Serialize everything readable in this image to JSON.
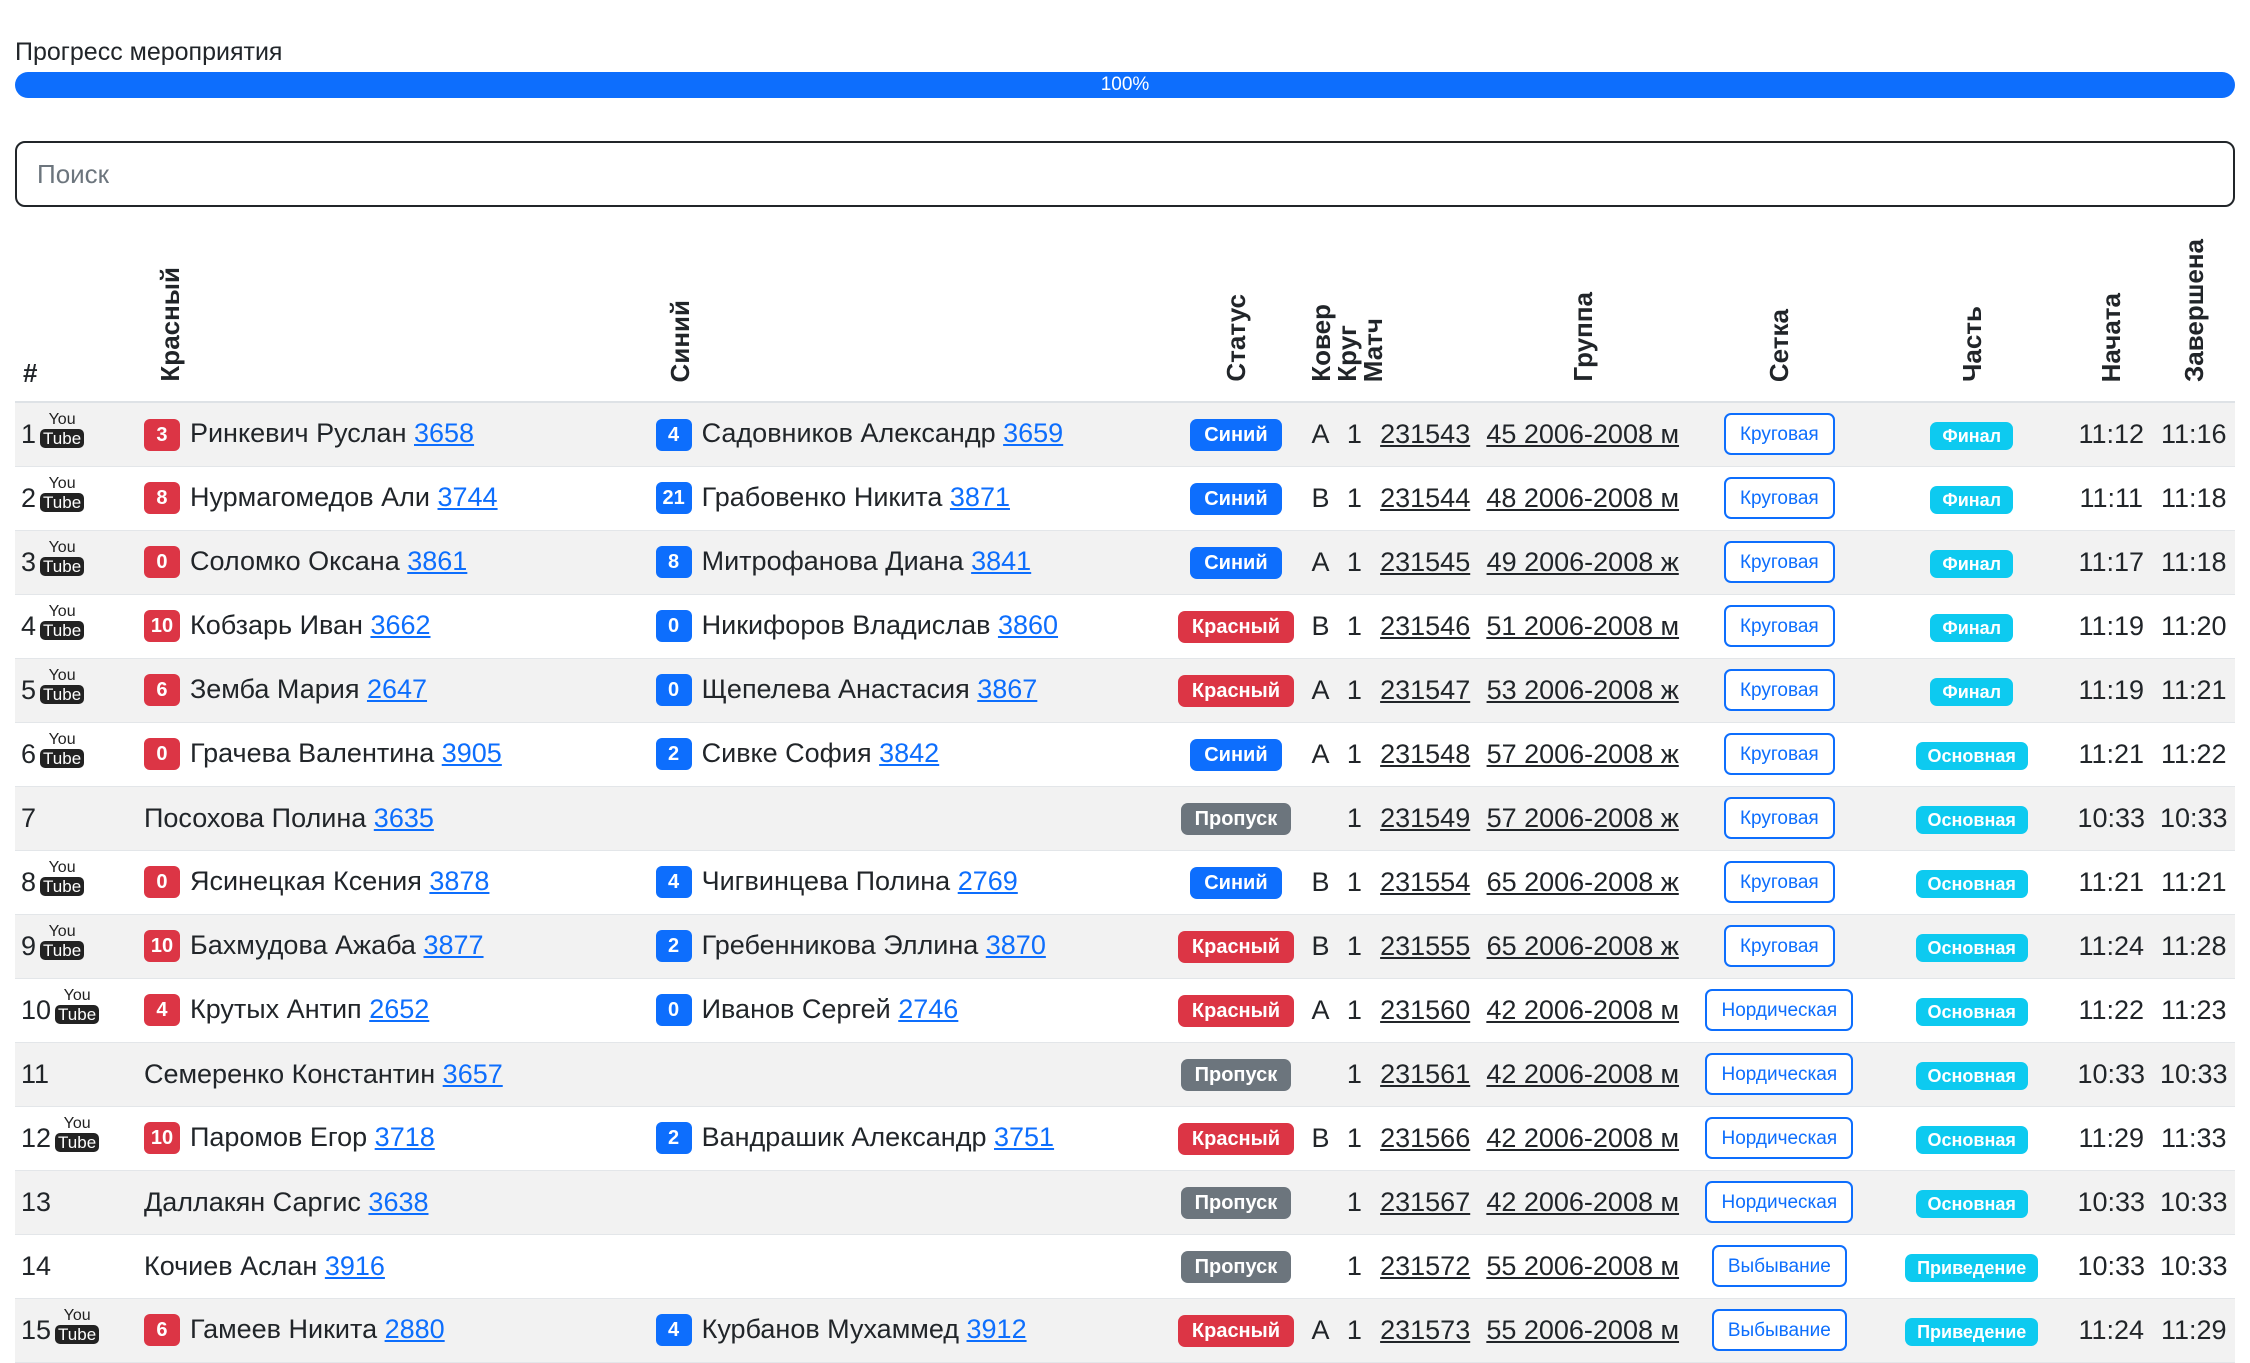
{
  "progress": {
    "label": "Прогресс мероприятия",
    "value_text": "100%",
    "value": 1.0
  },
  "search": {
    "placeholder": "Поиск",
    "value": ""
  },
  "colors": {
    "red": "#dc3545",
    "blue": "#0d6efd",
    "gray": "#6c757d",
    "cyan": "#0dcaf0"
  },
  "icons": {
    "youtube": "youtube-icon"
  },
  "youtube_logo": {
    "top": "You",
    "bottom": "Tube"
  },
  "columns": {
    "num": "#",
    "red": "Красный",
    "blue": "Синий",
    "status": "Статус",
    "mat": "Ковер",
    "round": "Круг",
    "match": "Матч",
    "group": "Группа",
    "grid": "Сетка",
    "part": "Часть",
    "start": "Начата",
    "end": "Завершена"
  },
  "rows": [
    {
      "n": "1",
      "yt": true,
      "rs": "3",
      "rn": "Ринкевич Руслан",
      "rid": "3658",
      "bs": "4",
      "bn": "Садовников Александр",
      "bid": "3659",
      "status": "Синий",
      "sc": "blue",
      "mat": "A",
      "round": "1",
      "match": "231543",
      "group": "45 2006-2008 м",
      "grid": "Круговая",
      "part": "Финал",
      "start": "11:12",
      "end": "11:16"
    },
    {
      "n": "2",
      "yt": true,
      "rs": "8",
      "rn": "Нурмагомедов Али",
      "rid": "3744",
      "bs": "21",
      "bn": "Грабовенко Никита",
      "bid": "3871",
      "status": "Синий",
      "sc": "blue",
      "mat": "B",
      "round": "1",
      "match": "231544",
      "group": "48 2006-2008 м",
      "grid": "Круговая",
      "part": "Финал",
      "start": "11:11",
      "end": "11:18"
    },
    {
      "n": "3",
      "yt": true,
      "rs": "0",
      "rn": "Соломко Оксана",
      "rid": "3861",
      "bs": "8",
      "bn": "Митрофанова Диана",
      "bid": "3841",
      "status": "Синий",
      "sc": "blue",
      "mat": "A",
      "round": "1",
      "match": "231545",
      "group": "49 2006-2008 ж",
      "grid": "Круговая",
      "part": "Финал",
      "start": "11:17",
      "end": "11:18"
    },
    {
      "n": "4",
      "yt": true,
      "rs": "10",
      "rn": "Кобзарь Иван",
      "rid": "3662",
      "bs": "0",
      "bn": "Никифоров Владислав",
      "bid": "3860",
      "status": "Красный",
      "sc": "red",
      "mat": "B",
      "round": "1",
      "match": "231546",
      "group": "51 2006-2008 м",
      "grid": "Круговая",
      "part": "Финал",
      "start": "11:19",
      "end": "11:20"
    },
    {
      "n": "5",
      "yt": true,
      "rs": "6",
      "rn": "Земба Мария",
      "rid": "2647",
      "bs": "0",
      "bn": "Щепелева Анастасия",
      "bid": "3867",
      "status": "Красный",
      "sc": "red",
      "mat": "A",
      "round": "1",
      "match": "231547",
      "group": "53 2006-2008 ж",
      "grid": "Круговая",
      "part": "Финал",
      "start": "11:19",
      "end": "11:21"
    },
    {
      "n": "6",
      "yt": true,
      "rs": "0",
      "rn": "Грачева Валентина",
      "rid": "3905",
      "bs": "2",
      "bn": "Сивке София",
      "bid": "3842",
      "status": "Синий",
      "sc": "blue",
      "mat": "A",
      "round": "1",
      "match": "231548",
      "group": "57 2006-2008 ж",
      "grid": "Круговая",
      "part": "Основная",
      "start": "11:21",
      "end": "11:22"
    },
    {
      "n": "7",
      "yt": false,
      "rs": "",
      "rn": "Посохова Полина",
      "rid": "3635",
      "bs": "",
      "bn": "",
      "bid": "",
      "status": "Пропуск",
      "sc": "gray",
      "mat": "",
      "round": "1",
      "match": "231549",
      "group": "57 2006-2008 ж",
      "grid": "Круговая",
      "part": "Основная",
      "start": "10:33",
      "end": "10:33"
    },
    {
      "n": "8",
      "yt": true,
      "rs": "0",
      "rn": "Ясинецкая Ксения",
      "rid": "3878",
      "bs": "4",
      "bn": "Чигвинцева Полина",
      "bid": "2769",
      "status": "Синий",
      "sc": "blue",
      "mat": "B",
      "round": "1",
      "match": "231554",
      "group": "65 2006-2008 ж",
      "grid": "Круговая",
      "part": "Основная",
      "start": "11:21",
      "end": "11:21"
    },
    {
      "n": "9",
      "yt": true,
      "rs": "10",
      "rn": "Бахмудова Ажаба",
      "rid": "3877",
      "bs": "2",
      "bn": "Гребенникова Эллина",
      "bid": "3870",
      "status": "Красный",
      "sc": "red",
      "mat": "B",
      "round": "1",
      "match": "231555",
      "group": "65 2006-2008 ж",
      "grid": "Круговая",
      "part": "Основная",
      "start": "11:24",
      "end": "11:28"
    },
    {
      "n": "10",
      "yt": true,
      "rs": "4",
      "rn": "Крутых Антип",
      "rid": "2652",
      "bs": "0",
      "bn": "Иванов Сергей",
      "bid": "2746",
      "status": "Красный",
      "sc": "red",
      "mat": "A",
      "round": "1",
      "match": "231560",
      "group": "42 2006-2008 м",
      "grid": "Нордическая",
      "part": "Основная",
      "start": "11:22",
      "end": "11:23"
    },
    {
      "n": "11",
      "yt": false,
      "rs": "",
      "rn": "Семеренко Константин",
      "rid": "3657",
      "bs": "",
      "bn": "",
      "bid": "",
      "status": "Пропуск",
      "sc": "gray",
      "mat": "",
      "round": "1",
      "match": "231561",
      "group": "42 2006-2008 м",
      "grid": "Нордическая",
      "part": "Основная",
      "start": "10:33",
      "end": "10:33"
    },
    {
      "n": "12",
      "yt": true,
      "rs": "10",
      "rn": "Паромов Егор",
      "rid": "3718",
      "bs": "2",
      "bn": "Вандрашик Александр",
      "bid": "3751",
      "status": "Красный",
      "sc": "red",
      "mat": "B",
      "round": "1",
      "match": "231566",
      "group": "42 2006-2008 м",
      "grid": "Нордическая",
      "part": "Основная",
      "start": "11:29",
      "end": "11:33"
    },
    {
      "n": "13",
      "yt": false,
      "rs": "",
      "rn": "Даллакян Саргис",
      "rid": "3638",
      "bs": "",
      "bn": "",
      "bid": "",
      "status": "Пропуск",
      "sc": "gray",
      "mat": "",
      "round": "1",
      "match": "231567",
      "group": "42 2006-2008 м",
      "grid": "Нордическая",
      "part": "Основная",
      "start": "10:33",
      "end": "10:33"
    },
    {
      "n": "14",
      "yt": false,
      "rs": "",
      "rn": "Кочиев Аслан",
      "rid": "3916",
      "bs": "",
      "bn": "",
      "bid": "",
      "status": "Пропуск",
      "sc": "gray",
      "mat": "",
      "round": "1",
      "match": "231572",
      "group": "55 2006-2008 м",
      "grid": "Выбывание",
      "part": "Приведение",
      "start": "10:33",
      "end": "10:33"
    },
    {
      "n": "15",
      "yt": true,
      "rs": "6",
      "rn": "Гамеев Никита",
      "rid": "2880",
      "bs": "4",
      "bn": "Курбанов Мухаммед",
      "bid": "3912",
      "status": "Красный",
      "sc": "red",
      "mat": "A",
      "round": "1",
      "match": "231573",
      "group": "55 2006-2008 м",
      "grid": "Выбывание",
      "part": "Приведение",
      "start": "11:24",
      "end": "11:29"
    }
  ]
}
